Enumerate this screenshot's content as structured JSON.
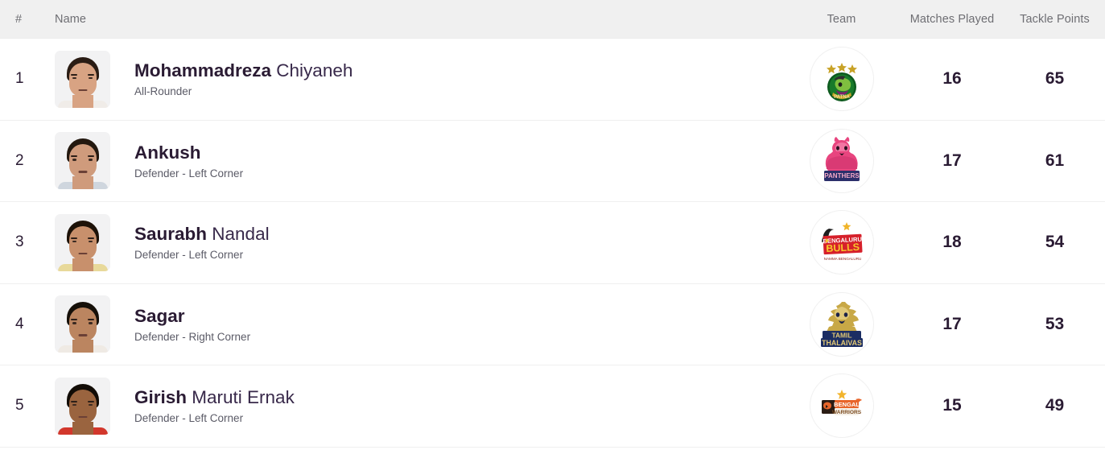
{
  "table": {
    "columns": {
      "rank": "#",
      "name": "Name",
      "team": "Team",
      "matches_played": "Matches Played",
      "tackle_points": "Tackle Points"
    },
    "rows": [
      {
        "rank": "1",
        "first_name": "Mohammadreza",
        "last_name": "Chiyaneh",
        "role": "All-Rounder",
        "team_logo": "patna-pirates-logo",
        "team_name": "Patna Pirates",
        "matches_played": "16",
        "tackle_points": "65",
        "avatar": {
          "hair": "#2a1c14",
          "skin": "#d8a383",
          "shirt": "#f0ece8"
        }
      },
      {
        "rank": "2",
        "first_name": "Ankush",
        "last_name": "",
        "role": "Defender - Left Corner",
        "team_logo": "jaipur-pink-panthers-logo",
        "team_name": "Jaipur Pink Panthers",
        "matches_played": "17",
        "tackle_points": "61",
        "avatar": {
          "hair": "#23180f",
          "skin": "#cf9b7c",
          "shirt": "#cfd6de"
        }
      },
      {
        "rank": "3",
        "first_name": "Saurabh",
        "last_name": "Nandal",
        "role": "Defender - Left Corner",
        "team_logo": "bengaluru-bulls-logo",
        "team_name": "Bengaluru Bulls",
        "matches_played": "18",
        "tackle_points": "54",
        "avatar": {
          "hair": "#1d1208",
          "skin": "#c8906c",
          "shirt": "#e8d99a"
        }
      },
      {
        "rank": "4",
        "first_name": "Sagar",
        "last_name": "",
        "role": "Defender - Right Corner",
        "team_logo": "tamil-thalaivas-logo",
        "team_name": "Tamil Thalaivas",
        "matches_played": "17",
        "tackle_points": "53",
        "avatar": {
          "hair": "#161009",
          "skin": "#bb8560",
          "shirt": "#efeae4"
        }
      },
      {
        "rank": "5",
        "first_name": "Girish",
        "last_name": "Maruti Ernak",
        "role": "Defender - Left Corner",
        "team_logo": "bengal-warriors-logo",
        "team_name": "Bengal Warriors",
        "matches_played": "15",
        "tackle_points": "49",
        "avatar": {
          "hair": "#120c06",
          "skin": "#9a643f",
          "shirt": "#d2372c"
        }
      }
    ]
  },
  "colors": {
    "header_bg": "#f0f0f0",
    "header_text": "#6e6e73",
    "row_bg": "#ffffff",
    "divider": "#efefef",
    "primary_text": "#2a1b33",
    "secondary_text": "#5a5a66",
    "avatar_bg": "#f2f2f3"
  }
}
